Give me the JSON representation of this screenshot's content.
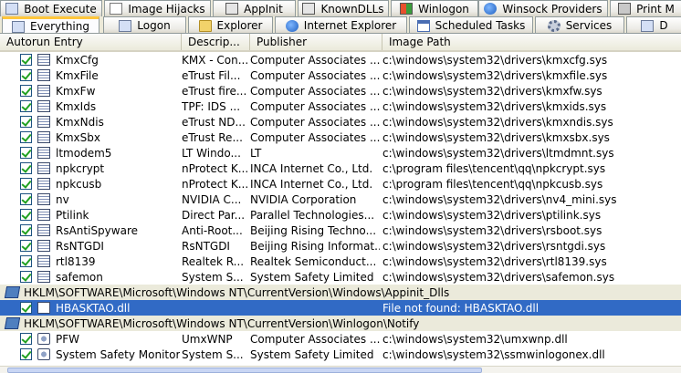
{
  "tabs_row1": [
    {
      "label": "Boot Execute",
      "icon": "box-icon",
      "active": false
    },
    {
      "label": "Image Hijacks",
      "icon": "doc-icon",
      "active": false
    },
    {
      "label": "AppInit",
      "icon": "dll-icon",
      "active": false
    },
    {
      "label": "KnownDLLs",
      "icon": "dll-icon",
      "active": false
    },
    {
      "label": "Winlogon",
      "icon": "win-icon",
      "active": false
    },
    {
      "label": "Winsock Providers",
      "icon": "globe-icon",
      "active": false
    },
    {
      "label": "Print M",
      "icon": "print-icon",
      "active": false
    }
  ],
  "tabs_row2": [
    {
      "label": "Everything",
      "icon": "box-icon",
      "active": true
    },
    {
      "label": "Logon",
      "icon": "box-icon",
      "active": false
    },
    {
      "label": "Explorer",
      "icon": "folder-icon",
      "active": false
    },
    {
      "label": "Internet Explorer",
      "icon": "globe-icon",
      "active": false
    },
    {
      "label": "Scheduled Tasks",
      "icon": "cal-icon",
      "active": false
    },
    {
      "label": "Services",
      "icon": "gear-icon",
      "active": false
    },
    {
      "label": "D",
      "icon": "box-icon",
      "active": false
    }
  ],
  "columns": {
    "entry": "Autorun Entry",
    "desc": "Descrip...",
    "publisher": "Publisher",
    "path": "Image Path"
  },
  "rows": [
    {
      "type": "item",
      "entry": "KmxCfg",
      "desc": "KMX - Con...",
      "publisher": "Computer Associates ...",
      "path": "c:\\windows\\system32\\drivers\\kmxcfg.sys"
    },
    {
      "type": "item",
      "entry": "KmxFile",
      "desc": "eTrust Fil...",
      "publisher": "Computer Associates ...",
      "path": "c:\\windows\\system32\\drivers\\kmxfile.sys"
    },
    {
      "type": "item",
      "entry": "KmxFw",
      "desc": "eTrust fire...",
      "publisher": "Computer Associates ...",
      "path": "c:\\windows\\system32\\drivers\\kmxfw.sys"
    },
    {
      "type": "item",
      "entry": "KmxIds",
      "desc": "TPF: IDS ...",
      "publisher": "Computer Associates ...",
      "path": "c:\\windows\\system32\\drivers\\kmxids.sys"
    },
    {
      "type": "item",
      "entry": "KmxNdis",
      "desc": "eTrust ND...",
      "publisher": "Computer Associates ...",
      "path": "c:\\windows\\system32\\drivers\\kmxndis.sys"
    },
    {
      "type": "item",
      "entry": "KmxSbx",
      "desc": "eTrust Re...",
      "publisher": "Computer Associates ...",
      "path": "c:\\windows\\system32\\drivers\\kmxsbx.sys"
    },
    {
      "type": "item",
      "entry": "ltmodem5",
      "desc": "LT Windo...",
      "publisher": "LT",
      "path": "c:\\windows\\system32\\drivers\\ltmdmnt.sys"
    },
    {
      "type": "item",
      "entry": "npkcrypt",
      "desc": "nProtect K...",
      "publisher": "INCA Internet Co., Ltd.",
      "path": "c:\\program files\\tencent\\qq\\npkcrypt.sys"
    },
    {
      "type": "item",
      "entry": "npkcusb",
      "desc": "nProtect K...",
      "publisher": "INCA Internet Co., Ltd.",
      "path": "c:\\program files\\tencent\\qq\\npkcusb.sys"
    },
    {
      "type": "item",
      "entry": "nv",
      "desc": "NVIDIA C...",
      "publisher": "NVIDIA Corporation",
      "path": "c:\\windows\\system32\\drivers\\nv4_mini.sys"
    },
    {
      "type": "item",
      "entry": "Ptilink",
      "desc": "Direct Par...",
      "publisher": "Parallel Technologies...",
      "path": "c:\\windows\\system32\\drivers\\ptilink.sys"
    },
    {
      "type": "item",
      "entry": "RsAntiSpyware",
      "desc": "Anti-Root...",
      "publisher": "Beijing Rising Techno...",
      "path": "c:\\windows\\system32\\drivers\\rsboot.sys"
    },
    {
      "type": "item",
      "entry": "RsNTGDI",
      "desc": "RsNTGDI",
      "publisher": "Beijing Rising Informat...",
      "path": "c:\\windows\\system32\\drivers\\rsntgdi.sys"
    },
    {
      "type": "item",
      "entry": "rtl8139",
      "desc": "Realtek R...",
      "publisher": "Realtek Semiconduct...",
      "path": "c:\\windows\\system32\\drivers\\rtl8139.sys"
    },
    {
      "type": "item",
      "entry": "safemon",
      "desc": "System S...",
      "publisher": "System Safety Limited",
      "path": "c:\\windows\\system32\\drivers\\safemon.sys"
    },
    {
      "type": "group",
      "text": "HKLM\\SOFTWARE\\Microsoft\\Windows NT\\CurrentVersion\\Windows\\Appinit_Dlls"
    },
    {
      "type": "item",
      "selected": true,
      "icon": "dll",
      "entry": "HBASKTAO.dll",
      "desc": "",
      "publisher": "",
      "path": "File not found: HBASKTAO.dll"
    },
    {
      "type": "group",
      "text": "HKLM\\SOFTWARE\\Microsoft\\Windows NT\\CurrentVersion\\Winlogon\\Notify"
    },
    {
      "type": "item",
      "icon": "gear",
      "entry": "PFW",
      "desc": "UmxWNP",
      "publisher": "Computer Associates ...",
      "path": "c:\\windows\\system32\\umxwnp.dll"
    },
    {
      "type": "item",
      "icon": "gear",
      "entry": "System Safety Monitor",
      "desc": "System S...",
      "publisher": "System Safety Limited",
      "path": "c:\\windows\\system32\\ssmwinlogonex.dll"
    }
  ],
  "colors": {
    "selection": "#316ac5",
    "group_bg": "#ebeadb",
    "active_tab_accent": "#ffc73c"
  }
}
